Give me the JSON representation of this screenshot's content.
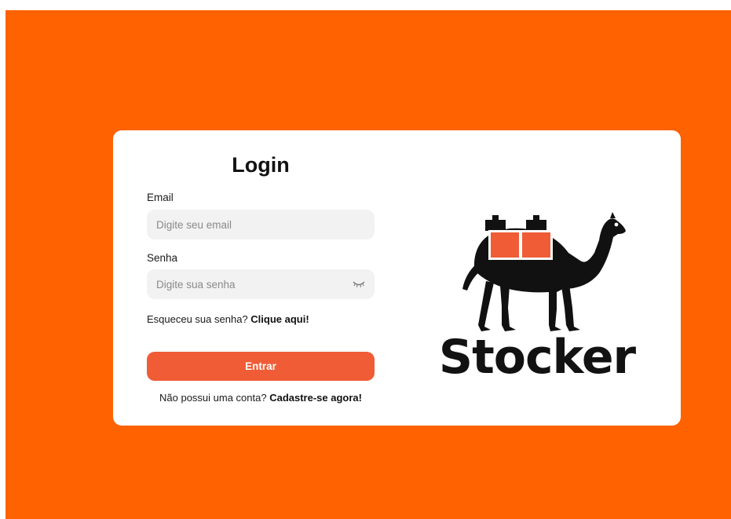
{
  "login": {
    "title": "Login",
    "email_label": "Email",
    "email_placeholder": "Digite seu email",
    "email_value": "",
    "password_label": "Senha",
    "password_placeholder": "Digite sua senha",
    "password_value": "",
    "forgot_text": "Esqueceu sua senha? ",
    "forgot_link": "Clique aqui!",
    "submit_label": "Entrar",
    "signup_text": "Não possui uma conta? ",
    "signup_link": "Cadastre-se agora!"
  },
  "brand": {
    "name": "Stocker",
    "logo_icon": "camel-with-boxes-icon"
  },
  "colors": {
    "background": "#ff6200",
    "accent": "#ef5c36",
    "card": "#ffffff",
    "input": "#f2f2f2",
    "text": "#121212"
  },
  "icons": {
    "password_toggle": "eye-closed-icon"
  }
}
